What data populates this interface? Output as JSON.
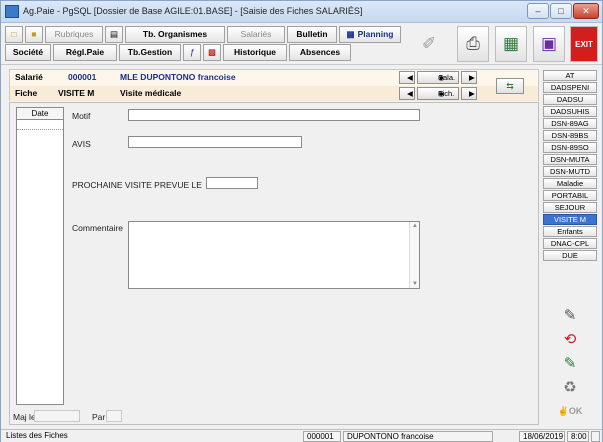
{
  "window": {
    "title": "Ag.Paie - PgSQL [Dossier de Base AGILE:01.BASE] - [Saisie des Fiches SALARIÉS]",
    "minimize": "–",
    "maximize": "□",
    "close": "✕"
  },
  "toolbar": {
    "row1": {
      "rubriques": "Rubriques",
      "organismes": "Tb. Organismes",
      "salaries": "Salariés",
      "bulletin": "Bulletin",
      "planning": "Planning"
    },
    "row2": {
      "societe": "Société",
      "reglpaie": "Régl.Paie",
      "gestion": "Tb.Gestion",
      "historique": "Historique",
      "absences": "Absences"
    },
    "exit_label": "EXIT"
  },
  "header": {
    "salarie_label": "Salarié",
    "salarie_id": "000001",
    "salarie_name": "MLE DUPONTONO francoise",
    "fiche_label": "Fiche",
    "fiche_code": "VISITE M",
    "fiche_name": "Visite médicale",
    "nav_sala": "Sala.",
    "nav_fich": "Fich."
  },
  "form": {
    "date_header": "Date",
    "motif_label": "Motif",
    "motif_value": "",
    "avis_label": "AVIS",
    "avis_value": "",
    "prochaine_label": "PROCHAINE VISITE PREVUE LE",
    "prochaine_value": "",
    "commentaire_label": "Commentaire",
    "commentaire_value": "",
    "majle_label": "Maj le",
    "par_label": "Par"
  },
  "tabs": [
    "AT",
    "DADSPENI",
    "DADSU",
    "DADSUHIS",
    "DSN-89AG",
    "DSN-89BS",
    "DSN-89SO",
    "DSN-MUTA",
    "DSN-MUTD",
    "Maladie",
    "PORTABIL",
    "SEJOUR",
    "VISITE M",
    "Enfants",
    "DNAC-CPL",
    "DUE"
  ],
  "active_tab": "VISITE M",
  "ok_label": "OK",
  "status": {
    "left": "Listes des Fiches",
    "id": "000001",
    "name": "DUPONTONO francoise",
    "date": "18/06/2019",
    "time": "8:00"
  }
}
